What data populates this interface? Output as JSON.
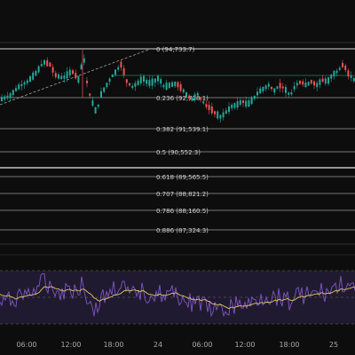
{
  "colors": {
    "background": "#0d0d0d",
    "up_candle": "#26a69a",
    "down_candle": "#ef5350",
    "fib_line": "#9a9a9a",
    "fib_highlight_line": "#d8d8d8",
    "trend_line": "#a0a0a0",
    "green_hline": "#2e7d5b",
    "rsi_band": "#2a2140",
    "rsi_line": "#7e57c2",
    "rsi_ma_line": "#e3c567",
    "time_text": "#a8a8a8"
  },
  "fibonacci": {
    "levels": [
      {
        "ratio": "0",
        "price": "(94,733.7)"
      },
      {
        "ratio": "0.236",
        "price": "(92,728.1)"
      },
      {
        "ratio": "0.382",
        "price": "(91,539.1)"
      },
      {
        "ratio": "0.5",
        "price": "(90,552.3)"
      },
      {
        "ratio": "0.618",
        "price": "(89,565.5)"
      },
      {
        "ratio": "0.707",
        "price": "(88,821.2)"
      },
      {
        "ratio": "0.786",
        "price": "(88,160.5)"
      },
      {
        "ratio": "0.886",
        "price": "(87,324.3)"
      }
    ]
  },
  "time_axis": {
    "labels": [
      "06:00",
      "12:00",
      "18:00",
      "24",
      "06:00",
      "12:00",
      "18:00",
      "25"
    ]
  },
  "indicator": {
    "name": "rsi-oscillator"
  }
}
